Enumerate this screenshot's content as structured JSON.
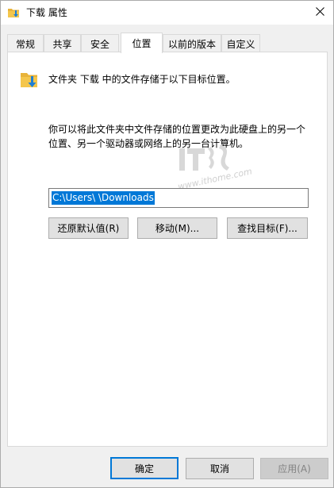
{
  "window": {
    "title": "下载 属性"
  },
  "tabs": [
    {
      "label": "常规"
    },
    {
      "label": "共享"
    },
    {
      "label": "安全"
    },
    {
      "label": "位置",
      "active": true
    },
    {
      "label": "以前的版本"
    },
    {
      "label": "自定义"
    }
  ],
  "location": {
    "headline": "文件夹 下载 中的文件存储于以下目标位置。",
    "description": "你可以将此文件夹中文件存储的位置更改为此硬盘上的另一个位置、另一个驱动器或网络上的另一台计算机。",
    "path": "C:\\Users\\          \\Downloads",
    "buttons": {
      "restore": "还原默认值(R)",
      "move": "移动(M)...",
      "find_target": "查找目标(F)..."
    }
  },
  "watermark": {
    "text": "www.ithome.com"
  },
  "footer": {
    "ok": "确定",
    "cancel": "取消",
    "apply": "应用(A)"
  },
  "colors": {
    "accent": "#0078d7",
    "folder": "#f4c64c",
    "arrow": "#1e7fd4"
  }
}
